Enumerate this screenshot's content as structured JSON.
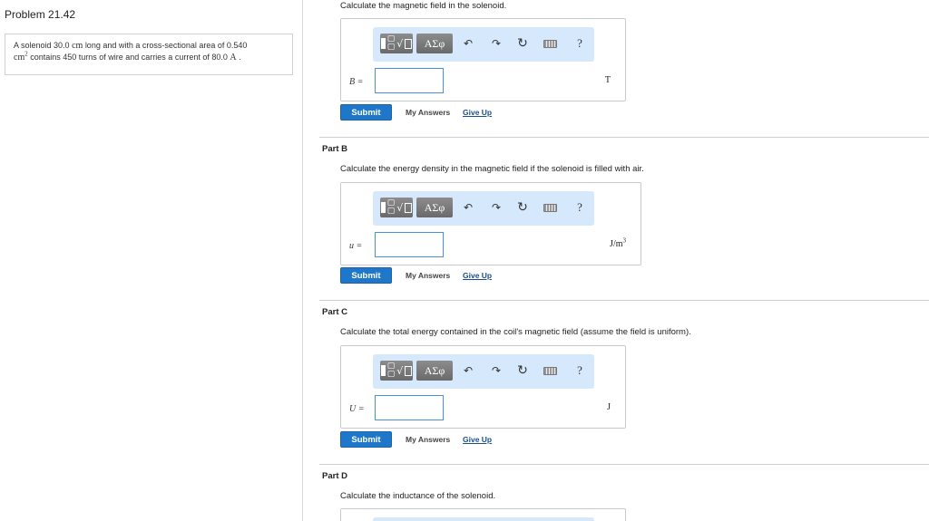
{
  "problem": {
    "title": "Problem 21.42",
    "text_1": "A solenoid 30.0",
    "unit_cm": "cm",
    "text_2": "long and with a cross-sectional area of 0.540",
    "unit_cm2": "cm",
    "unit_cm2_exp": "2",
    "text_3": "contains 450 turns of wire and carries a current of 80.0",
    "unit_A": "A",
    "text_end": "."
  },
  "toolbar": {
    "greek_label": "ΑΣφ",
    "frac_label": "√",
    "undo_icon": "↶",
    "redo_icon": "↷",
    "reset_icon": "↻",
    "help_label": "?"
  },
  "part_a": {
    "prompt": "Calculate the magnetic field in the solenoid.",
    "variable": "B =",
    "input_value": "",
    "unit": "T",
    "submit_label": "Submit",
    "my_answers_label": "My Answers",
    "give_up_label": "Give Up"
  },
  "part_b": {
    "title": "Part B",
    "prompt": "Calculate the energy density in the magnetic field if the solenoid is filled with air.",
    "variable": "u =",
    "input_value": "",
    "unit": "J/m",
    "unit_exp": "3",
    "submit_label": "Submit",
    "my_answers_label": "My Answers",
    "give_up_label": "Give Up"
  },
  "part_c": {
    "title": "Part C",
    "prompt": "Calculate the total energy contained in the coil's magnetic field (assume the field is uniform).",
    "variable": "U =",
    "input_value": "",
    "unit": "J",
    "submit_label": "Submit",
    "my_answers_label": "My Answers",
    "give_up_label": "Give Up"
  },
  "part_d": {
    "title": "Part D",
    "prompt": "Calculate the inductance of the solenoid."
  }
}
